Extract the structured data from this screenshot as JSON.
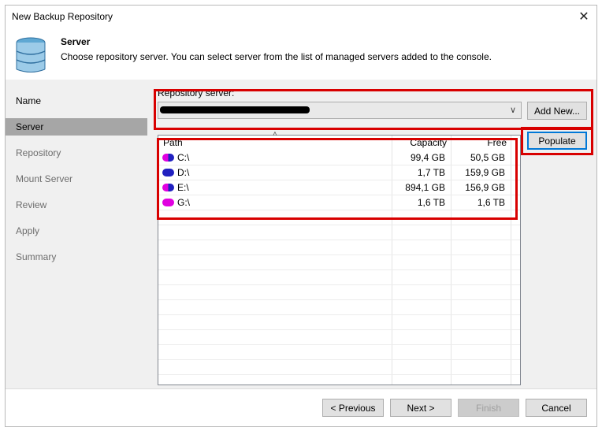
{
  "window": {
    "title": "New Backup Repository",
    "close_glyph": "✕"
  },
  "header": {
    "title": "Server",
    "description": "Choose repository server. You can select server from the list of managed servers added to the console."
  },
  "sidebar": {
    "items": [
      {
        "label": "Name",
        "state": "done"
      },
      {
        "label": "Server",
        "state": "active"
      },
      {
        "label": "Repository",
        "state": "pending"
      },
      {
        "label": "Mount Server",
        "state": "pending"
      },
      {
        "label": "Review",
        "state": "pending"
      },
      {
        "label": "Apply",
        "state": "pending"
      },
      {
        "label": "Summary",
        "state": "pending"
      }
    ]
  },
  "repo_server": {
    "label": "Repository server:",
    "value": "",
    "add_new_label": "Add New...",
    "populate_label": "Populate"
  },
  "table": {
    "headers": {
      "path": "Path",
      "capacity": "Capacity",
      "free": "Free"
    },
    "rows": [
      {
        "path": "C:\\",
        "capacity": "99,4 GB",
        "free": "50,5 GB",
        "icon": "disk-icon",
        "colors": [
          "#e000e0",
          "#2020c0"
        ]
      },
      {
        "path": "D:\\",
        "capacity": "1,7 TB",
        "free": "159,9 GB",
        "icon": "disk-icon",
        "colors": [
          "#2020c0",
          "#2020c0"
        ]
      },
      {
        "path": "E:\\",
        "capacity": "894,1 GB",
        "free": "156,9 GB",
        "icon": "disk-icon",
        "colors": [
          "#e000e0",
          "#2020c0"
        ]
      },
      {
        "path": "G:\\",
        "capacity": "1,6 TB",
        "free": "1,6 TB",
        "icon": "disk-icon",
        "colors": [
          "#e000e0",
          "#e000e0"
        ]
      }
    ]
  },
  "footer": {
    "previous_label": "< Previous",
    "next_label": "Next >",
    "finish_label": "Finish",
    "cancel_label": "Cancel"
  },
  "colors": {
    "highlight": "#d80000",
    "active_nav": "#a6a6a6",
    "panel_bg": "#f0f0f0"
  }
}
